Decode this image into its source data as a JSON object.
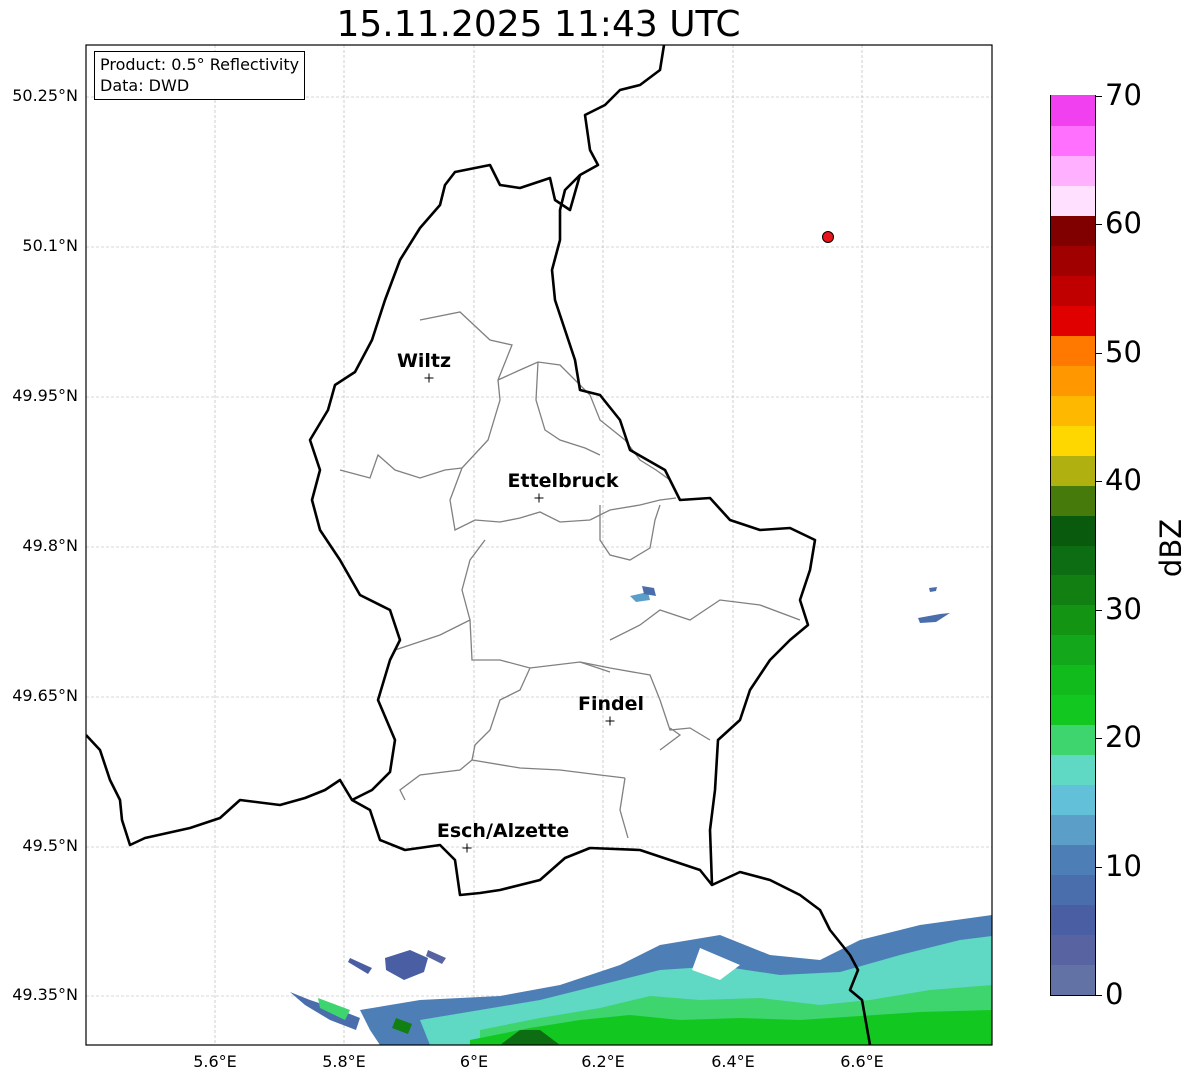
{
  "title": "15.11.2025 11:43 UTC",
  "info": {
    "product": "Product: 0.5° Reflectivity",
    "source": "Data: DWD"
  },
  "lat_labels": [
    "50.25°N",
    "50.1°N",
    "49.95°N",
    "49.8°N",
    "49.65°N",
    "49.5°N",
    "49.35°N"
  ],
  "lon_labels": [
    "5.6°E",
    "5.8°E",
    "6°E",
    "6.2°E",
    "6.4°E",
    "6.6°E"
  ],
  "cities": [
    {
      "name": "Wiltz"
    },
    {
      "name": "Ettelbruck"
    },
    {
      "name": "Findel"
    },
    {
      "name": "Esch/Alzette"
    }
  ],
  "colorbar": {
    "label": "dBZ",
    "tick_labels": [
      "0",
      "10",
      "20",
      "30",
      "40",
      "50",
      "60",
      "70"
    ],
    "colors": [
      "#6272a4",
      "#5864a1",
      "#4a5fa3",
      "#4a6eab",
      "#4d7fb6",
      "#5b9fc9",
      "#63c0d9",
      "#5fd8c4",
      "#3ed46e",
      "#12c820",
      "#12bb1c",
      "#13a81b",
      "#139412",
      "#117f12",
      "#0c6d12",
      "#0a5a0e",
      "#467a0a",
      "#b0b010",
      "#ffd700",
      "#ffb800",
      "#ff9800",
      "#ff7800",
      "#e00000",
      "#c00000",
      "#a00000",
      "#800000",
      "#ffe0ff",
      "#ffb0ff",
      "#ff70ff",
      "#f040f0"
    ]
  },
  "radar_site": "radar-site"
}
